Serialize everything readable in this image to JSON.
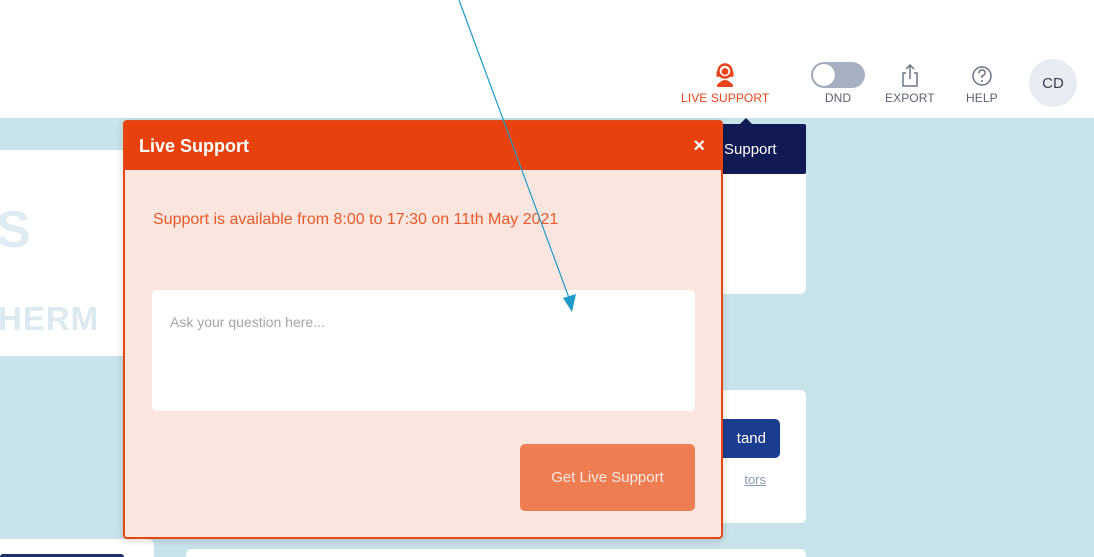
{
  "topbar": {
    "live_support_label": "LIVE SUPPORT",
    "dnd_label": "DND",
    "export_label": "EXPORT",
    "help_label": "HELP",
    "avatar_initials": "CD",
    "dnd_enabled": false
  },
  "background": {
    "logo_letter": "S",
    "logo_text": "HERM",
    "tooltip_text": "Support",
    "stand_button_label": "tand",
    "link_text": "tors"
  },
  "popup": {
    "title": "Live Support",
    "close_label": "×",
    "message": "Support is available from 8:00 to 17:30 on 11th May 2021",
    "input_placeholder": "Ask your question here...",
    "input_value": "",
    "button_label": "Get Live Support"
  },
  "colors": {
    "accent": "#e8410d",
    "popup_bg": "#fbe5df",
    "button": "#ef7d52",
    "app_bg": "#c8e3ea",
    "annotation_arrow": "#1d9bc9"
  },
  "icons": {
    "live_support": "headset-icon",
    "export": "share-export-icon",
    "help": "question-circle-icon"
  }
}
